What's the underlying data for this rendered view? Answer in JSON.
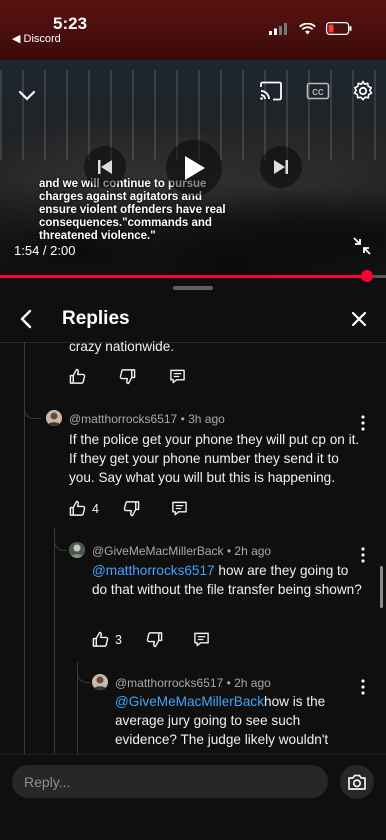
{
  "status_bar": {
    "time": "5:23",
    "back_label": "◀ Discord"
  },
  "video": {
    "caption": "and we will continue to pursue charges against agitators and ensure violent offenders have real consequences.\"commands and threatened violence.\"",
    "time_current": "1:54",
    "time_total": "2:00",
    "time_display": "1:54 / 2:00",
    "progress": 0.95,
    "accent_color": "#ff0033"
  },
  "panel": {
    "title": "Replies"
  },
  "comments": [
    {
      "text_partial": "crazy nationwide.",
      "likes": ""
    },
    {
      "author": "@matthorrocks6517",
      "age": "3h ago",
      "meta": "@matthorrocks6517 • 3h ago",
      "text": "If the police get your phone they will put cp on it. If they get your phone number they send it to you. Say what you will but this is happening.",
      "likes": "4"
    },
    {
      "author": "@GiveMeMacMillerBack",
      "age": "2h ago",
      "meta": "@GiveMeMacMillerBack • 2h ago",
      "mention": "@matthorrocks6517",
      "text": " how are they going to do that without the file transfer being shown?",
      "likes": "3"
    },
    {
      "author": "@matthorrocks6517",
      "age": "2h ago",
      "meta": "@matthorrocks6517 • 2h ago",
      "mention": "@GiveMeMacMillerBack",
      "text": "how is the average jury going to see such evidence? The judge likely wouldn't",
      "likes": ""
    }
  ],
  "composer": {
    "placeholder": "Reply..."
  },
  "icons": {
    "back": "chevron-left-icon",
    "close": "close-icon",
    "like": "thumb-up-icon",
    "dislike": "thumb-down-icon",
    "reply": "comment-icon",
    "more": "more-vertical-icon",
    "camera": "camera-icon",
    "cast": "cast-icon",
    "captions": "closed-captions-icon",
    "settings": "gear-icon"
  }
}
